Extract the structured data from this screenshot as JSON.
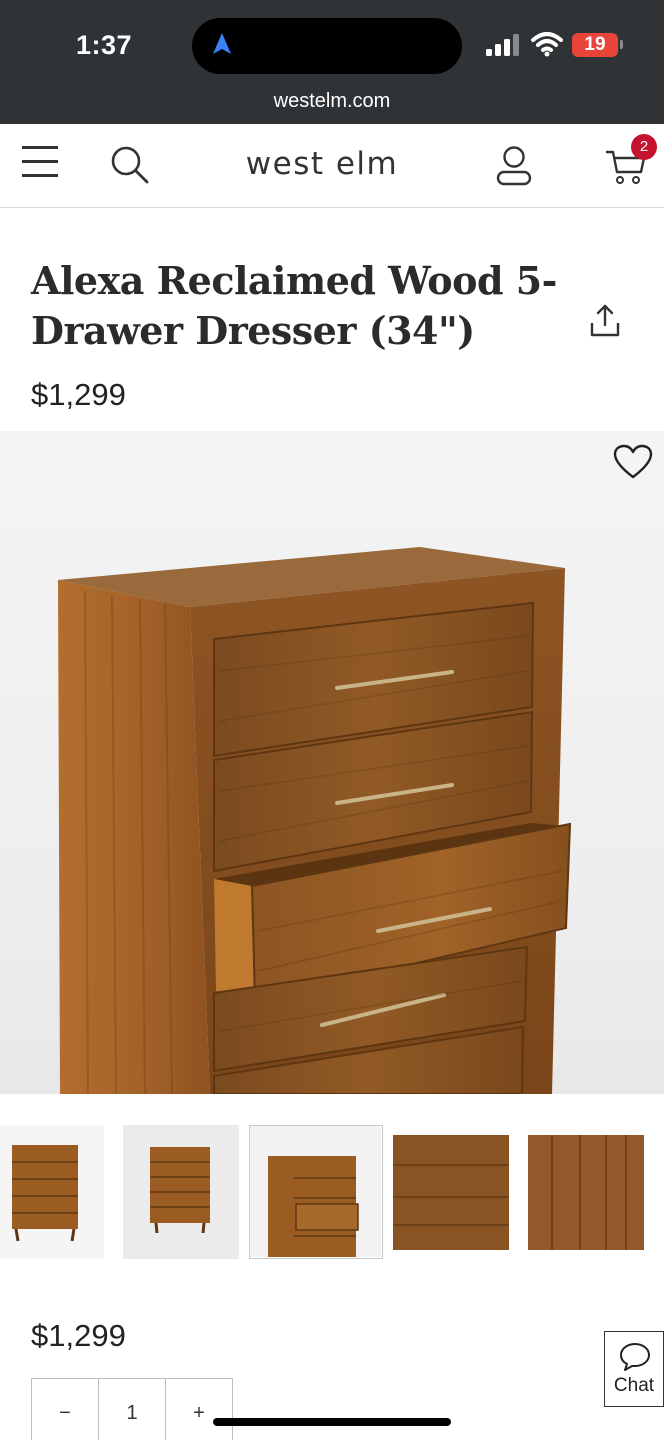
{
  "status_bar": {
    "time": "1:37",
    "battery": "19",
    "url": "westelm.com"
  },
  "header": {
    "logo": "west elm",
    "cart_count": "2"
  },
  "product": {
    "title": "Alexa Reclaimed Wood 5-Drawer Dresser (34\")",
    "price": "$1,299",
    "selected_thumbnail": 3,
    "thumbnail_count": 5
  },
  "purchase": {
    "price": "$1,299",
    "quantity_decrement": "−",
    "quantity": "1",
    "quantity_increment": "+"
  },
  "chat": {
    "label": "Chat"
  },
  "colors": {
    "status_bar_bg": "#2f3336",
    "badge": "#c4122f",
    "battery": "#e8443a",
    "wood": "#9b5c23"
  }
}
